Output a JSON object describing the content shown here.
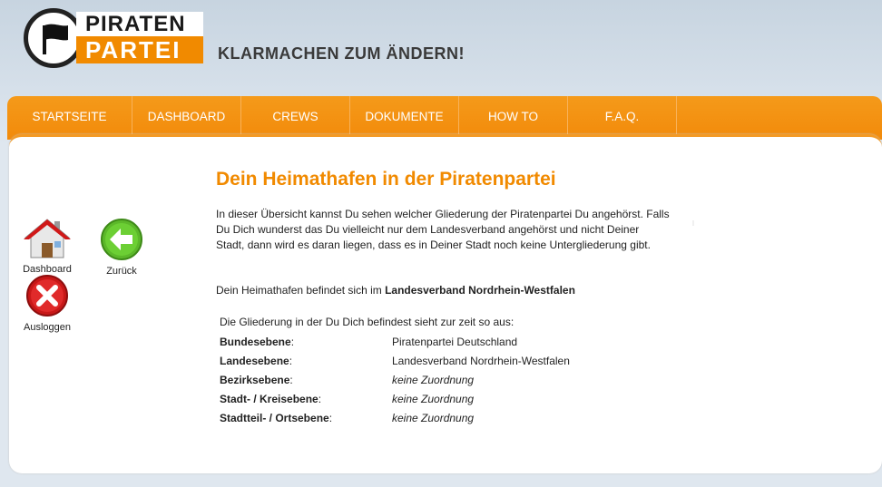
{
  "header": {
    "logo_top": "PIRATEN",
    "logo_bottom": "PARTEI",
    "slogan": "KLARMACHEN ZUM ÄNDERN!"
  },
  "nav": {
    "items": [
      {
        "label": "STARTSEITE"
      },
      {
        "label": "DASHBOARD"
      },
      {
        "label": "CREWS"
      },
      {
        "label": "DOKUMENTE"
      },
      {
        "label": "HOW TO"
      },
      {
        "label": "F.A.Q."
      }
    ]
  },
  "sidebar": {
    "dashboard_label": "Dashboard",
    "back_label": "Zurück",
    "logout_label": "Ausloggen"
  },
  "main": {
    "title": "Dein Heimathafen in der Piratenpartei",
    "paragraph1": "In dieser Übersicht kannst Du sehen welcher Gliederung der Piratenpartei Du angehörst. Falls Du Dich wunderst das Du vielleicht nur dem Landesverband angehörst und nicht Deiner Stadt, dann wird es daran liegen, dass es in Deiner Stadt noch keine Untergliederung gibt.",
    "paragraph2_prefix": "Dein Heimathafen befindet sich im ",
    "paragraph2_bold": "Landesverband Nordrhein-Westfalen",
    "intro": "Die Gliederung in der Du Dich befindest sieht zur zeit so aus:",
    "levels": [
      {
        "key": "Bundesebene",
        "value": "Piratenpartei Deutschland"
      },
      {
        "key": "Landesebene",
        "value": "Landesverband Nordrhein-Westfalen"
      },
      {
        "key": "Bezirksebene",
        "value": "keine Zuordnung"
      },
      {
        "key": "Stadt- / Kreisebene",
        "value": "keine Zuordnung"
      },
      {
        "key": "Stadtteil- / Ortsebene",
        "value": "keine Zuordnung"
      }
    ]
  },
  "colors": {
    "accent": "#f18a00",
    "nav_bg": "#f28a0a"
  }
}
